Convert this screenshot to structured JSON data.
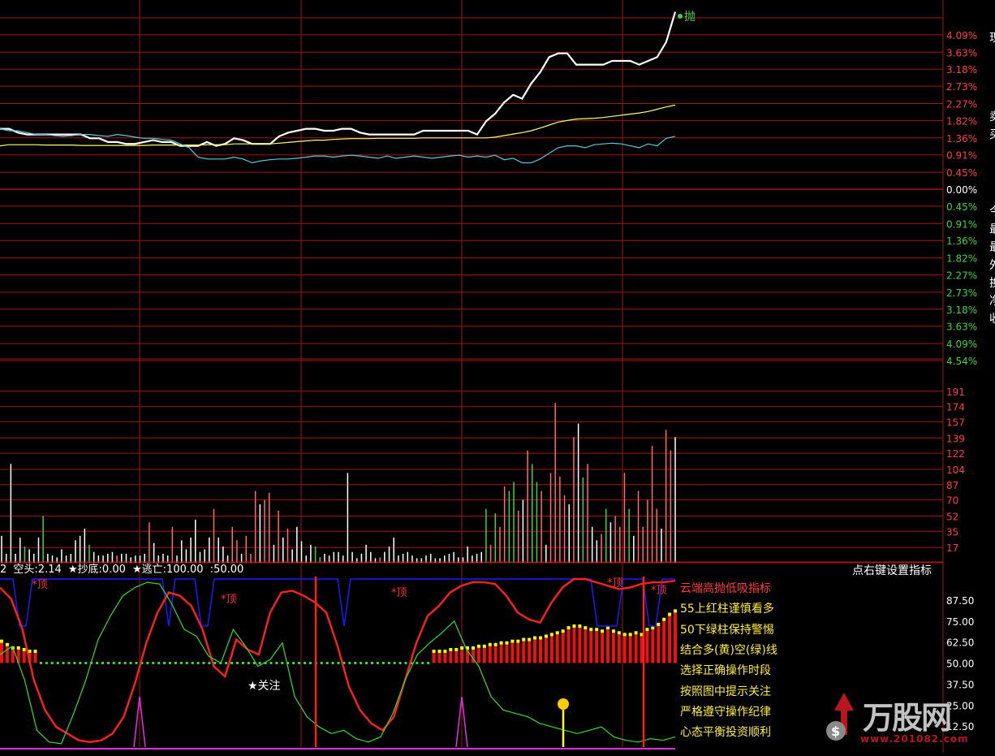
{
  "colors": {
    "grid": "#a31616",
    "price": "#ffffff",
    "avg": "#ffff66",
    "ref": "#5fc8d8",
    "up": "#ff3b3b",
    "down": "#3bd13b",
    "blue": "#1a1aff",
    "magenta": "#e030e0",
    "yellow": "#ffff00"
  },
  "price_panel": {
    "sell_marker_label": "抛",
    "axis_labels_up": [
      "4.09%",
      "3.63%",
      "3.18%",
      "2.73%",
      "2.27%",
      "1.82%",
      "1.36%",
      "0.91%",
      "0.45%",
      "0.00%"
    ],
    "axis_labels_down": [
      "0.45%",
      "0.91%",
      "1.36%",
      "1.82%",
      "2.27%",
      "2.73%",
      "3.18%",
      "3.63%",
      "4.09%",
      "4.54%"
    ]
  },
  "volume_panel": {
    "axis_labels": [
      "191",
      "174",
      "157",
      "139",
      "122",
      "104",
      "87",
      "70",
      "52",
      "35",
      "17"
    ]
  },
  "indicator_panel": {
    "header": {
      "prefix": "2",
      "item1": "空头:2.14",
      "item2": "★抄底:0.00",
      "item3": "★逃亡:100.00",
      "item4": ":50.00"
    },
    "settings_hint": "点右键设置指标",
    "axis_labels": [
      "87.50",
      "75.00",
      "62.50",
      "50.00",
      "37.50",
      "25.00",
      "12.50"
    ],
    "top_labels": [
      "*顶",
      "*顶",
      "*顶",
      "*顶",
      "*顶"
    ],
    "focus_label": "★关注",
    "notes": [
      {
        "text": "云端高抛低吸指标",
        "color": "#ff3b3b"
      },
      {
        "text": "55上红柱谨慎看多",
        "color": "#ffee44"
      },
      {
        "text": "50下绿柱保持警惕",
        "color": "#ffee44"
      },
      {
        "text": "结合多(黄)空(绿)线",
        "color": "#ffee44"
      },
      {
        "text": "选择正确操作时段",
        "color": "#ffee44"
      },
      {
        "text": "按照图中提示关注",
        "color": "#ffee44"
      },
      {
        "text": "严格遵守操作纪律",
        "color": "#ffee44"
      },
      {
        "text": "心态平衡投资顺利",
        "color": "#ffee44"
      }
    ]
  },
  "side_chars": [
    "现",
    "卖",
    "买",
    "今",
    "最",
    "最",
    "外",
    "换",
    "净",
    "收"
  ],
  "logo": {
    "text": "万股网",
    "url": "www.201082.com"
  },
  "chart_data": [
    {
      "type": "line",
      "ylim": [
        -4.54,
        4.54
      ],
      "series": [
        {
          "values": [
            1.6,
            1.6,
            1.5,
            1.45,
            1.45,
            1.45,
            1.45,
            1.45,
            1.45,
            1.45,
            1.35,
            1.35,
            1.25,
            1.25,
            1.2,
            1.2,
            1.25,
            1.3,
            1.25,
            1.25,
            1.15,
            1.15,
            1.15,
            1.25,
            1.15,
            1.2,
            1.35,
            1.3,
            1.2,
            1.2,
            1.2,
            1.4,
            1.5,
            1.55,
            1.6,
            1.6,
            1.55,
            1.55,
            1.6,
            1.6,
            1.5,
            1.45,
            1.45,
            1.45,
            1.45,
            1.45,
            1.45,
            1.55,
            1.55,
            1.55,
            1.55,
            1.55,
            1.55,
            1.45,
            1.8,
            2.0,
            2.3,
            2.5,
            2.4,
            2.8,
            3.1,
            3.5,
            3.6,
            3.6,
            3.3,
            3.3,
            3.3,
            3.3,
            3.4,
            3.4,
            3.4,
            3.3,
            3.4,
            3.5,
            3.9,
            4.7
          ]
        },
        {
          "values": [
            1.15,
            1.18,
            1.18,
            1.18,
            1.18,
            1.17,
            1.17,
            1.17,
            1.17,
            1.16,
            1.16,
            1.16,
            1.16,
            1.16,
            1.16,
            1.16,
            1.16,
            1.17,
            1.17,
            1.17,
            1.17,
            1.17,
            1.17,
            1.18,
            1.18,
            1.18,
            1.2,
            1.2,
            1.2,
            1.2,
            1.2,
            1.22,
            1.24,
            1.26,
            1.28,
            1.3,
            1.3,
            1.32,
            1.33,
            1.34,
            1.34,
            1.34,
            1.35,
            1.35,
            1.35,
            1.35,
            1.35,
            1.36,
            1.36,
            1.36,
            1.36,
            1.36,
            1.36,
            1.36,
            1.36,
            1.38,
            1.42,
            1.46,
            1.5,
            1.55,
            1.62,
            1.7,
            1.78,
            1.82,
            1.86,
            1.87,
            1.88,
            1.9,
            1.93,
            1.96,
            1.99,
            2.02,
            2.06,
            2.12,
            2.18,
            2.23
          ]
        },
        {
          "values": [
            1.6,
            1.55,
            1.55,
            1.5,
            1.45,
            1.45,
            1.42,
            1.4,
            1.42,
            1.45,
            1.45,
            1.42,
            1.4,
            1.45,
            1.42,
            1.38,
            1.35,
            1.35,
            1.32,
            1.3,
            1.2,
            1.1,
            0.85,
            0.8,
            0.8,
            0.8,
            0.85,
            0.8,
            0.7,
            0.75,
            0.78,
            0.8,
            0.8,
            0.82,
            0.85,
            0.88,
            0.88,
            0.85,
            0.88,
            0.9,
            0.88,
            0.85,
            0.82,
            0.88,
            0.82,
            0.85,
            0.88,
            0.85,
            0.82,
            0.85,
            0.88,
            0.9,
            0.85,
            0.88,
            0.85,
            0.9,
            0.78,
            0.82,
            0.7,
            0.7,
            0.8,
            0.95,
            1.1,
            1.15,
            1.15,
            1.1,
            1.18,
            1.2,
            1.22,
            1.2,
            1.15,
            1.1,
            1.2,
            1.15,
            1.35,
            1.4
          ]
        }
      ]
    },
    {
      "type": "bar",
      "ylim": [
        0,
        208
      ],
      "values": [
        30,
        10,
        110,
        10,
        28,
        18,
        15,
        10,
        28,
        52,
        10,
        8,
        6,
        15,
        8,
        10,
        25,
        30,
        38,
        20,
        12,
        8,
        8,
        10,
        12,
        8,
        10,
        10,
        6,
        8,
        8,
        10,
        45,
        22,
        8,
        10,
        8,
        40,
        8,
        25,
        15,
        28,
        48,
        12,
        15,
        28,
        60,
        28,
        18,
        8,
        40,
        25,
        10,
        30,
        10,
        80,
        65,
        70,
        78,
        20,
        58,
        28,
        38,
        15,
        40,
        24,
        8,
        20,
        18,
        6,
        10,
        8,
        12,
        12,
        8,
        100,
        12,
        5,
        10,
        20,
        12,
        5,
        6,
        12,
        18,
        28,
        8,
        10,
        12,
        8,
        5,
        5,
        8,
        10,
        5,
        5,
        8,
        10,
        12,
        6,
        6,
        18,
        8,
        10,
        12,
        60,
        20,
        55,
        40,
        85,
        80,
        90,
        58,
        70,
        125,
        110,
        90,
        80,
        20,
        100,
        178,
        96,
        75,
        65,
        140,
        155,
        95,
        110,
        40,
        25,
        32,
        60,
        45,
        52,
        40,
        100,
        60,
        30,
        80,
        40,
        70,
        130,
        60,
        38,
        148,
        125,
        140
      ],
      "colors": [
        "w",
        "w",
        "w",
        "w",
        "w",
        "g",
        "w",
        "w",
        "w",
        "g",
        "w",
        "w",
        "w",
        "w",
        "w",
        "w",
        "w",
        "w",
        "w",
        "g",
        "w",
        "w",
        "w",
        "w",
        "w",
        "r",
        "w",
        "w",
        "w",
        "w",
        "w",
        "w",
        "r",
        "w",
        "w",
        "w",
        "w",
        "r",
        "w",
        "w",
        "w",
        "w",
        "w",
        "w",
        "w",
        "w",
        "r",
        "w",
        "w",
        "w",
        "r",
        "r",
        "w",
        "r",
        "r",
        "r",
        "w",
        "r",
        "r",
        "w",
        "r",
        "w",
        "r",
        "w",
        "w",
        "w",
        "w",
        "w",
        "g",
        "g",
        "w",
        "w",
        "w",
        "w",
        "w",
        "w",
        "w",
        "w",
        "w",
        "w",
        "w",
        "w",
        "r",
        "w",
        "w",
        "w",
        "w",
        "w",
        "w",
        "w",
        "w",
        "w",
        "w",
        "w",
        "w",
        "w",
        "w",
        "w",
        "w",
        "w",
        "w",
        "w",
        "w",
        "w",
        "w",
        "g",
        "r",
        "g",
        "r",
        "r",
        "g",
        "g",
        "r",
        "w",
        "r",
        "g",
        "g",
        "r",
        "w",
        "r",
        "r",
        "r",
        "r",
        "w",
        "r",
        "w",
        "g",
        "r",
        "w",
        "w",
        "r",
        "g",
        "w",
        "r",
        "r",
        "r",
        "g",
        "w",
        "r",
        "r",
        "r",
        "r",
        "r",
        "w",
        "r",
        "r",
        "w"
      ]
    },
    {
      "type": "line",
      "ylim": [
        0,
        100
      ],
      "series": [
        {
          "values": [
            100,
            100,
            100,
            100,
            100,
            100,
            100,
            100,
            100,
            100,
            100,
            100,
            100,
            100,
            100,
            100,
            100,
            100,
            100,
            100,
            100,
            100,
            80,
            100,
            100,
            100,
            100,
            80,
            100,
            100,
            100,
            100,
            100,
            100,
            100,
            100,
            100,
            100,
            100,
            100,
            100,
            100,
            100,
            100,
            100,
            100,
            100,
            100,
            100,
            100,
            100,
            100,
            100,
            100,
            100,
            100,
            100,
            100,
            100,
            100,
            100,
            100,
            100,
            100,
            100,
            100,
            100,
            100,
            100,
            100,
            100,
            100,
            100,
            100,
            100,
            100,
            100,
            100,
            100,
            100,
            100,
            100,
            100,
            100,
            100,
            100,
            100,
            100,
            100,
            100,
            100,
            100,
            100,
            100,
            100,
            100,
            100,
            100,
            100,
            100,
            100,
            100,
            100,
            100,
            100,
            100,
            100,
            100,
            100,
            100,
            100,
            100,
            100,
            100,
            100,
            100,
            100,
            100,
            100,
            100,
            100,
            100,
            100,
            100,
            100,
            100,
            100,
            100,
            100,
            100,
            100,
            100,
            100,
            100,
            100,
            100,
            100,
            100,
            100,
            100,
            100,
            100,
            100,
            100,
            100,
            100,
            100,
            100,
            100,
            100,
            100,
            100,
            100,
            100,
            100,
            100,
            100,
            100,
            100,
            100,
            100,
            100,
            100,
            100,
            100,
            100,
            100,
            100,
            100,
            100,
            100,
            100,
            100,
            100,
            100,
            100,
            100,
            100,
            100,
            100,
            100
          ]
        },
        {
          "values": [
            95,
            88,
            70,
            40,
            22,
            12,
            8,
            4,
            3,
            4,
            8,
            18,
            38,
            62,
            80,
            92,
            90,
            84,
            70,
            48,
            42,
            64,
            58,
            55,
            80,
            92,
            93,
            90,
            86,
            80,
            60,
            36,
            22,
            14,
            10,
            18,
            40,
            62,
            78,
            84,
            92,
            96,
            98,
            98,
            97,
            90,
            80,
            76,
            74,
            86,
            95,
            100,
            100,
            98,
            96,
            94,
            95,
            97,
            98,
            98,
            99
          ]
        },
        {
          "values": [
            55,
            60,
            40,
            10,
            3,
            2,
            20,
            40,
            64,
            78,
            90,
            95,
            98,
            97,
            85,
            70,
            66,
            54,
            50,
            70,
            60,
            48,
            52,
            62,
            30,
            18,
            12,
            8,
            10,
            5,
            3,
            6,
            20,
            40,
            55,
            62,
            68,
            75,
            58,
            48,
            30,
            22,
            20,
            18,
            14,
            12,
            10,
            8,
            10,
            12,
            6,
            4,
            3,
            5,
            4,
            6
          ]
        }
      ],
      "bars": [
        62,
        60,
        58,
        58,
        57,
        56,
        56,
        55,
        55,
        54,
        54,
        54,
        53,
        53,
        52,
        52,
        52,
        52,
        52,
        52,
        52,
        52,
        52,
        52,
        52,
        52,
        52,
        52,
        52,
        53,
        53,
        53,
        53,
        54,
        54,
        54,
        54,
        54,
        55,
        55,
        55,
        55,
        55,
        55,
        55,
        55,
        55,
        55,
        55,
        55,
        54,
        54,
        54,
        54,
        53,
        53,
        53,
        53,
        53,
        53,
        53,
        53,
        53,
        53,
        53,
        53,
        53,
        53,
        53,
        53,
        53,
        54,
        54,
        55,
        55,
        55,
        55,
        56,
        56,
        56,
        57,
        57,
        58,
        58,
        58,
        59,
        59,
        60,
        60,
        61,
        61,
        62,
        62,
        63,
        63,
        64,
        64,
        65,
        66,
        67,
        68,
        70,
        71,
        71,
        70,
        69,
        69,
        68,
        70,
        68,
        67,
        66,
        66,
        67,
        66,
        69,
        70,
        72,
        75,
        78,
        80
      ]
    }
  ]
}
